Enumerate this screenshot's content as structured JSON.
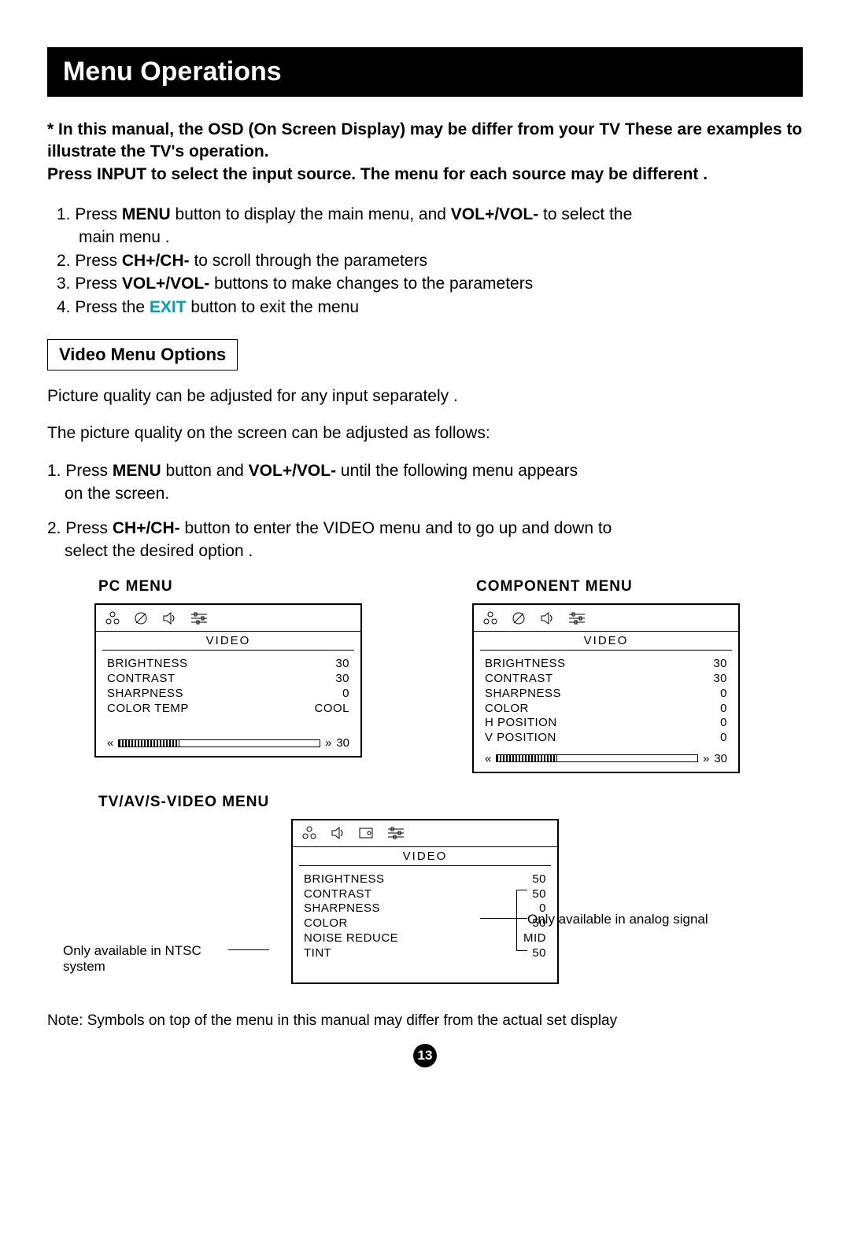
{
  "page_number": "13",
  "title": "Menu Operations",
  "intro": {
    "line1": "* In this manual, the OSD (On Screen Display) may be differ from your TV These are examples to illustrate the TV's operation.",
    "line2": "Press INPUT to select the input source. The menu for each source may be different ."
  },
  "steps": {
    "s1a": "1. Press ",
    "s1b": "MENU",
    "s1c": " button to  display the main menu, and ",
    "s1d": "VOL+/VOL-",
    "s1e": " to select the",
    "s1f": "main menu .",
    "s2a": "2. Press ",
    "s2b": "CH+/CH-",
    "s2c": " to scroll through the parameters",
    "s3a": "3. Press ",
    "s3b": "VOL+/VOL-",
    "s3c": " buttons to make changes to the parameters",
    "s4a": "4. Press the ",
    "s4b": "EXIT",
    "s4c": " button to exit the menu"
  },
  "section_box": "Video Menu Options",
  "para1": "Picture quality can be adjusted for any input separately .",
  "para2": "The picture quality on the screen can be adjusted as follows:",
  "vsteps": {
    "v1a": "1. Press ",
    "v1b": "MENU",
    "v1c": " button and ",
    "v1d": "VOL+/VOL-",
    "v1e": " until the following menu appears",
    "v1f": "on the screen.",
    "v2a": "2. Press ",
    "v2b": "CH+/CH-",
    "v2c": " button to enter the VIDEO  menu and to go up and down to",
    "v2d": "select the desired option ."
  },
  "menus": {
    "pc": {
      "label": "PC MENU",
      "heading": "VIDEO",
      "rows": [
        {
          "name": "BRIGHTNESS",
          "val": "30"
        },
        {
          "name": "CONTRAST",
          "val": "30"
        },
        {
          "name": "SHARPNESS",
          "val": "0"
        },
        {
          "name": "COLOR TEMP",
          "val": "COOL"
        }
      ],
      "slider_val": "30"
    },
    "component": {
      "label": "COMPONENT MENU",
      "heading": "VIDEO",
      "rows": [
        {
          "name": "BRIGHTNESS",
          "val": "30"
        },
        {
          "name": "CONTRAST",
          "val": "30"
        },
        {
          "name": "SHARPNESS",
          "val": "0"
        },
        {
          "name": "COLOR",
          "val": "0"
        },
        {
          "name": "H POSITION",
          "val": "0"
        },
        {
          "name": "V POSITION",
          "val": "0"
        }
      ],
      "slider_val": "30"
    },
    "tvav": {
      "label": "TV/AV/S-VIDEO MENU",
      "heading": "VIDEO",
      "rows": [
        {
          "name": "BRIGHTNESS",
          "val": "50"
        },
        {
          "name": "CONTRAST",
          "val": "50"
        },
        {
          "name": "SHARPNESS",
          "val": "0"
        },
        {
          "name": "COLOR",
          "val": "50"
        },
        {
          "name": "NOISE REDUCE",
          "val": "MID"
        },
        {
          "name": "TINT",
          "val": "50"
        }
      ]
    }
  },
  "callouts": {
    "left": "Only available in NTSC system",
    "right": "Only available in analog signal"
  },
  "note": "Note: Symbols on top of the menu in this manual may differ from the actual set display"
}
